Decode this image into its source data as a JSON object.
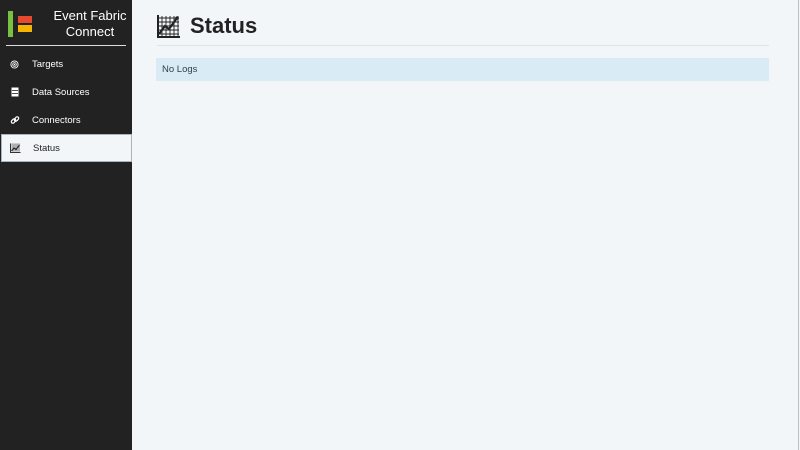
{
  "brand": {
    "title": "Event Fabric Connect"
  },
  "sidebar": {
    "items": [
      {
        "label": "Targets",
        "icon": "target-icon",
        "active": false
      },
      {
        "label": "Data Sources",
        "icon": "database-icon",
        "active": false
      },
      {
        "label": "Connectors",
        "icon": "link-icon",
        "active": false
      },
      {
        "label": "Status",
        "icon": "chart-icon",
        "active": true
      }
    ]
  },
  "main": {
    "title": "Status",
    "title_icon": "chart-icon",
    "alert_text": "No Logs"
  },
  "colors": {
    "sidebar_bg": "#222222",
    "page_bg": "#f2f6f9",
    "alert_bg": "#d9ecf6",
    "logo_green": "#7ac142",
    "logo_red": "#e64a2e",
    "logo_yellow": "#f5b400"
  }
}
